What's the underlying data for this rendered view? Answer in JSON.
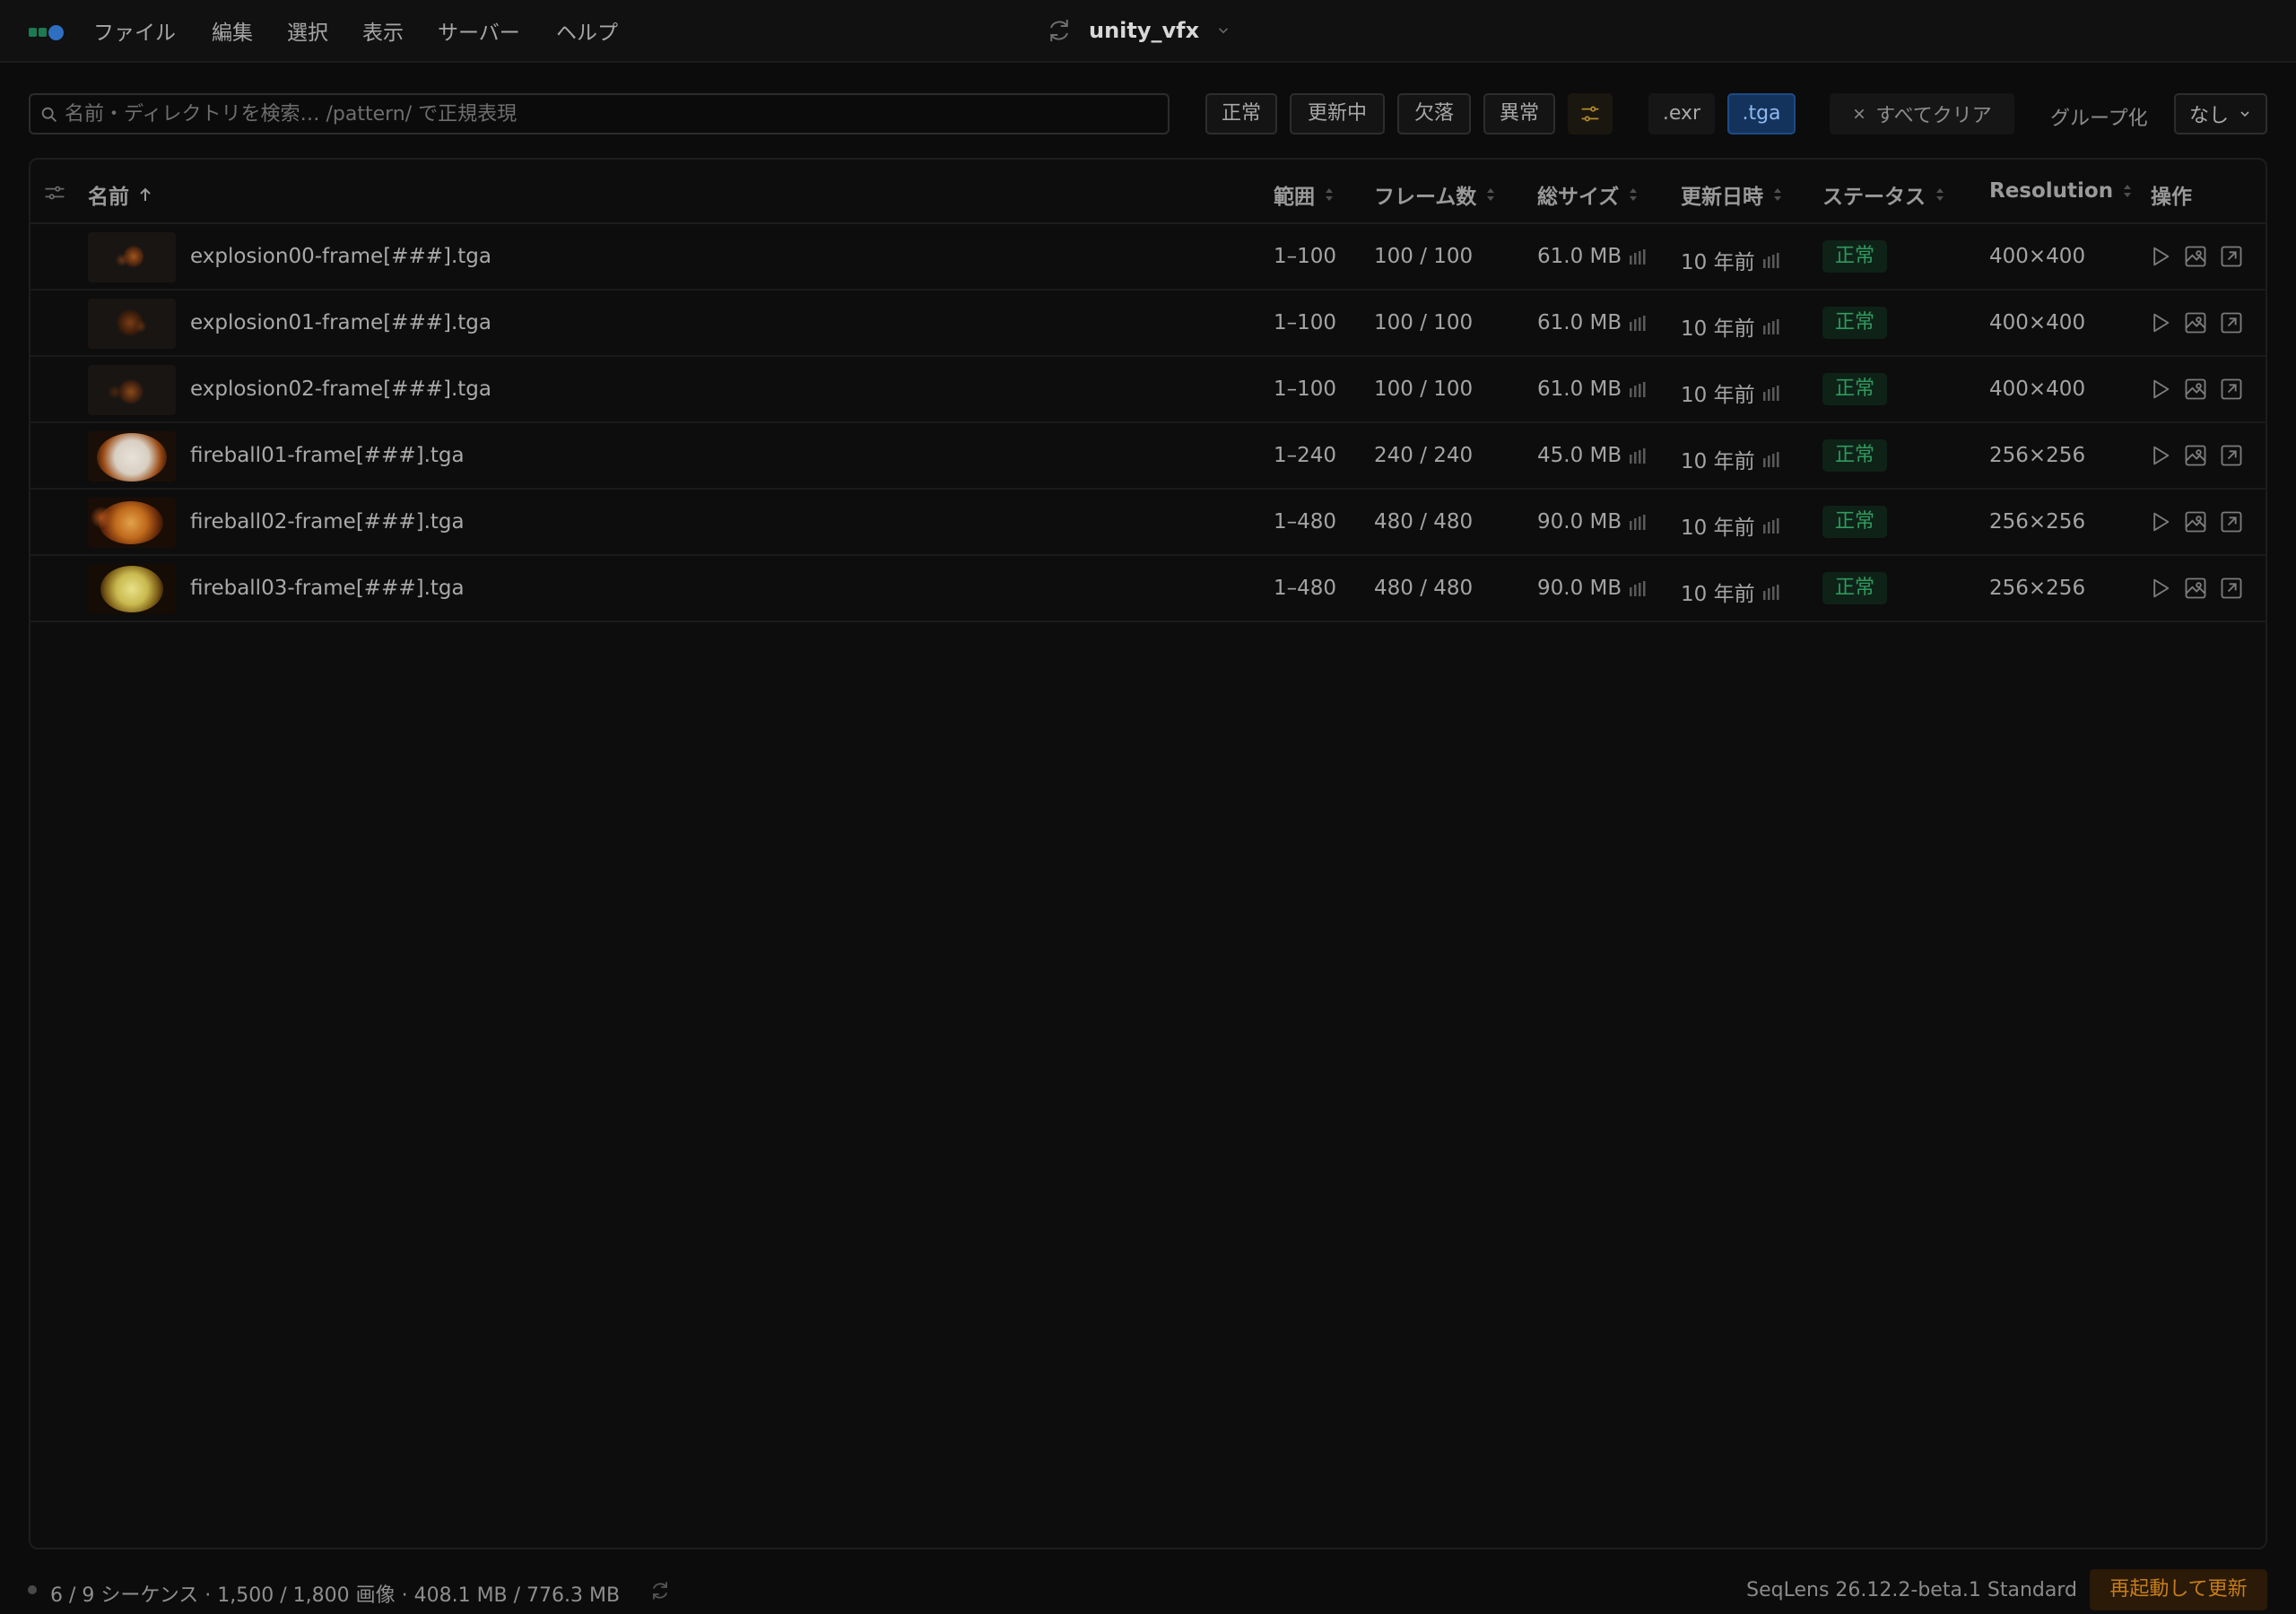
{
  "menu": {
    "items": [
      "ファイル",
      "編集",
      "選択",
      "表示",
      "サーバー",
      "ヘルプ"
    ],
    "project": "unity_vfx"
  },
  "toolbar": {
    "search_placeholder": "名前・ディレクトリを検索… /pattern/ で正規表現",
    "status_filters": [
      "正常",
      "更新中",
      "欠落",
      "異常"
    ],
    "ext_filters": [
      ".exr",
      ".tga"
    ],
    "active_ext": ".tga",
    "clear_all": "すべてクリア",
    "group_label": "グループ化",
    "group_value": "なし"
  },
  "table": {
    "columns": {
      "name": "名前",
      "range": "範囲",
      "frames": "フレーム数",
      "size": "総サイズ",
      "modified": "更新日時",
      "status": "ステータス",
      "resolution": "Resolution",
      "actions": "操作"
    },
    "rows": [
      {
        "name": "explosion00-frame[###].tga",
        "range": "1–100",
        "frames": "100 / 100",
        "size": "61.0 MB",
        "modified": "10 年前",
        "status": "正常",
        "resolution": "400×400",
        "thumb": "dark-explosion"
      },
      {
        "name": "explosion01-frame[###].tga",
        "range": "1–100",
        "frames": "100 / 100",
        "size": "61.0 MB",
        "modified": "10 年前",
        "status": "正常",
        "resolution": "400×400",
        "thumb": "dark-explosion"
      },
      {
        "name": "explosion02-frame[###].tga",
        "range": "1–100",
        "frames": "100 / 100",
        "size": "61.0 MB",
        "modified": "10 年前",
        "status": "正常",
        "resolution": "400×400",
        "thumb": "dark-explosion"
      },
      {
        "name": "fireball01-frame[###].tga",
        "range": "1–240",
        "frames": "240 / 240",
        "size": "45.0 MB",
        "modified": "10 年前",
        "status": "正常",
        "resolution": "256×256",
        "thumb": "white-fireball"
      },
      {
        "name": "fireball02-frame[###].tga",
        "range": "1–480",
        "frames": "480 / 480",
        "size": "90.0 MB",
        "modified": "10 年前",
        "status": "正常",
        "resolution": "256×256",
        "thumb": "orange-fireball"
      },
      {
        "name": "fireball03-frame[###].tga",
        "range": "1–480",
        "frames": "480 / 480",
        "size": "90.0 MB",
        "modified": "10 年前",
        "status": "正常",
        "resolution": "256×256",
        "thumb": "yellow-fireball"
      }
    ]
  },
  "statusbar": {
    "summary": "6 / 9 シーケンス · 1,500 / 1,800 画像 · 408.1 MB / 776.3 MB",
    "version": "SeqLens 26.12.2-beta.1 Standard",
    "update_button": "再起動して更新"
  },
  "colors": {
    "background": "#0c0c0c",
    "status_ok": "#2f9a5e",
    "accent_blue": "#13335c",
    "update_orange": "#c77d1b"
  },
  "icons": [
    "sync-icon",
    "chevron-down-icon",
    "search-icon",
    "sliders-icon",
    "close-icon",
    "column-settings-icon",
    "sort-icon",
    "histogram-icon",
    "play-icon",
    "image-icon",
    "open-external-icon"
  ]
}
